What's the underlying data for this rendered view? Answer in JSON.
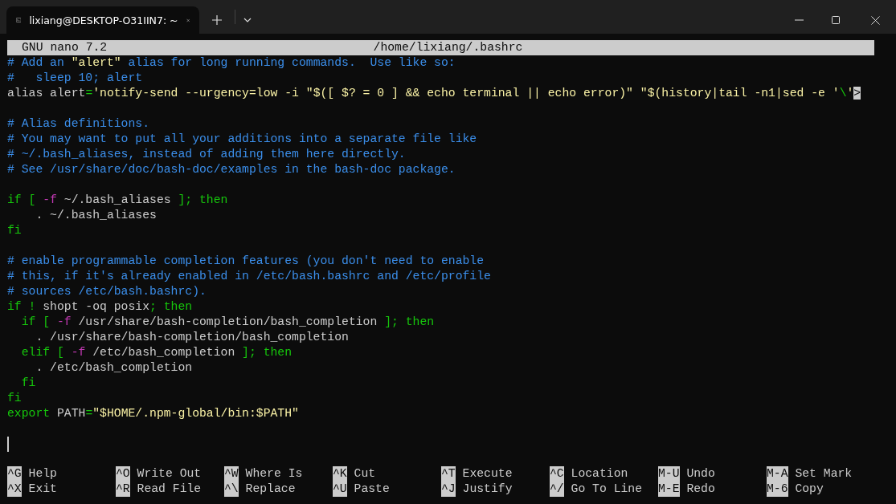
{
  "window": {
    "tab": {
      "title": "lixiang@DESKTOP-O31IIN7: ~",
      "selected": true
    }
  },
  "titlebar": {
    "app": "GNU nano 7.2",
    "file": "/home/lixiang/.bashrc"
  },
  "lines": [
    {
      "kind": "code",
      "segments": [
        {
          "kind": "comment",
          "text": "# Add an "
        },
        {
          "kind": "string",
          "text": "\"alert\""
        },
        {
          "kind": "comment",
          "text": " alias for long running commands.  Use like so:"
        }
      ]
    },
    {
      "kind": "code",
      "segments": [
        {
          "kind": "comment",
          "text": "#   sleep 10; alert"
        }
      ]
    },
    {
      "kind": "code",
      "segments": [
        {
          "kind": "plain",
          "text": "alias alert"
        },
        {
          "kind": "keyword",
          "text": "="
        },
        {
          "kind": "string",
          "text": "'notify-send --urgency=low -i \"$([ $? = 0 ] && echo terminal || echo error)\" \"$(history|tail -n1|sed -e '"
        },
        {
          "kind": "keyword",
          "text": "\\"
        },
        {
          "kind": "string",
          "text": "'"
        },
        {
          "kind": "overflow",
          "text": ">"
        }
      ]
    },
    {
      "kind": "blank"
    },
    {
      "kind": "code",
      "segments": [
        {
          "kind": "comment",
          "text": "# Alias definitions."
        }
      ]
    },
    {
      "kind": "code",
      "segments": [
        {
          "kind": "comment",
          "text": "# You may want to put all your additions into a separate file like"
        }
      ]
    },
    {
      "kind": "code",
      "segments": [
        {
          "kind": "comment",
          "text": "# ~/.bash_aliases, instead of adding them here directly."
        }
      ]
    },
    {
      "kind": "code",
      "segments": [
        {
          "kind": "comment",
          "text": "# See /usr/share/doc/bash-doc/examples in the bash-doc package."
        }
      ]
    },
    {
      "kind": "blank"
    },
    {
      "kind": "code",
      "segments": [
        {
          "kind": "keyword",
          "text": "if [ "
        },
        {
          "kind": "flag",
          "text": "-f"
        },
        {
          "kind": "plain",
          "text": " ~/.bash_aliases "
        },
        {
          "kind": "keyword",
          "text": "]; then"
        }
      ]
    },
    {
      "kind": "code",
      "segments": [
        {
          "kind": "plain",
          "text": "    . ~/.bash_aliases"
        }
      ]
    },
    {
      "kind": "code",
      "segments": [
        {
          "kind": "keyword",
          "text": "fi"
        }
      ]
    },
    {
      "kind": "blank"
    },
    {
      "kind": "code",
      "segments": [
        {
          "kind": "comment",
          "text": "# enable programmable completion features (you don't need to enable"
        }
      ]
    },
    {
      "kind": "code",
      "segments": [
        {
          "kind": "comment",
          "text": "# this, if it's already enabled in /etc/bash.bashrc and /etc/profile"
        }
      ]
    },
    {
      "kind": "code",
      "segments": [
        {
          "kind": "comment",
          "text": "# sources /etc/bash.bashrc)."
        }
      ]
    },
    {
      "kind": "code",
      "segments": [
        {
          "kind": "keyword",
          "text": "if !"
        },
        {
          "kind": "plain",
          "text": " shopt -oq posix"
        },
        {
          "kind": "keyword",
          "text": "; then"
        }
      ]
    },
    {
      "kind": "code",
      "segments": [
        {
          "kind": "keyword",
          "text": "  if [ "
        },
        {
          "kind": "flag",
          "text": "-f"
        },
        {
          "kind": "plain",
          "text": " /usr/share/bash-completion/bash_completion "
        },
        {
          "kind": "keyword",
          "text": "]; then"
        }
      ]
    },
    {
      "kind": "code",
      "segments": [
        {
          "kind": "plain",
          "text": "    . /usr/share/bash-completion/bash_completion"
        }
      ]
    },
    {
      "kind": "code",
      "segments": [
        {
          "kind": "keyword",
          "text": "  elif [ "
        },
        {
          "kind": "flag",
          "text": "-f"
        },
        {
          "kind": "plain",
          "text": " /etc/bash_completion "
        },
        {
          "kind": "keyword",
          "text": "]; then"
        }
      ]
    },
    {
      "kind": "code",
      "segments": [
        {
          "kind": "plain",
          "text": "    . /etc/bash_completion"
        }
      ]
    },
    {
      "kind": "code",
      "segments": [
        {
          "kind": "keyword",
          "text": "  fi"
        }
      ]
    },
    {
      "kind": "code",
      "segments": [
        {
          "kind": "keyword",
          "text": "fi"
        }
      ]
    },
    {
      "kind": "code",
      "segments": [
        {
          "kind": "keyword",
          "text": "export"
        },
        {
          "kind": "plain",
          "text": " PATH"
        },
        {
          "kind": "keyword",
          "text": "="
        },
        {
          "kind": "string",
          "text": "\"$HOME/.npm-global/bin:$PATH\""
        }
      ]
    },
    {
      "kind": "blank"
    },
    {
      "kind": "cursor"
    }
  ],
  "shortcut_bar": {
    "rows": [
      {
        "items": [
          {
            "key": "^G",
            "label": "Help"
          },
          {
            "key": "^O",
            "label": "Write Out"
          },
          {
            "key": "^W",
            "label": "Where Is"
          },
          {
            "key": "^K",
            "label": "Cut"
          },
          {
            "key": "^T",
            "label": "Execute"
          },
          {
            "key": "^C",
            "label": "Location"
          },
          {
            "key": "M-U",
            "label": "Undo"
          },
          {
            "key": "M-A",
            "label": "Set Mark"
          }
        ]
      },
      {
        "items": [
          {
            "key": "^X",
            "label": "Exit"
          },
          {
            "key": "^R",
            "label": "Read File"
          },
          {
            "key": "^\\",
            "label": "Replace"
          },
          {
            "key": "^U",
            "label": "Paste"
          },
          {
            "key": "^J",
            "label": "Justify"
          },
          {
            "key": "^/",
            "label": "Go To Line"
          },
          {
            "key": "M-E",
            "label": "Redo"
          },
          {
            "key": "M-6",
            "label": "Copy"
          }
        ]
      }
    ]
  }
}
